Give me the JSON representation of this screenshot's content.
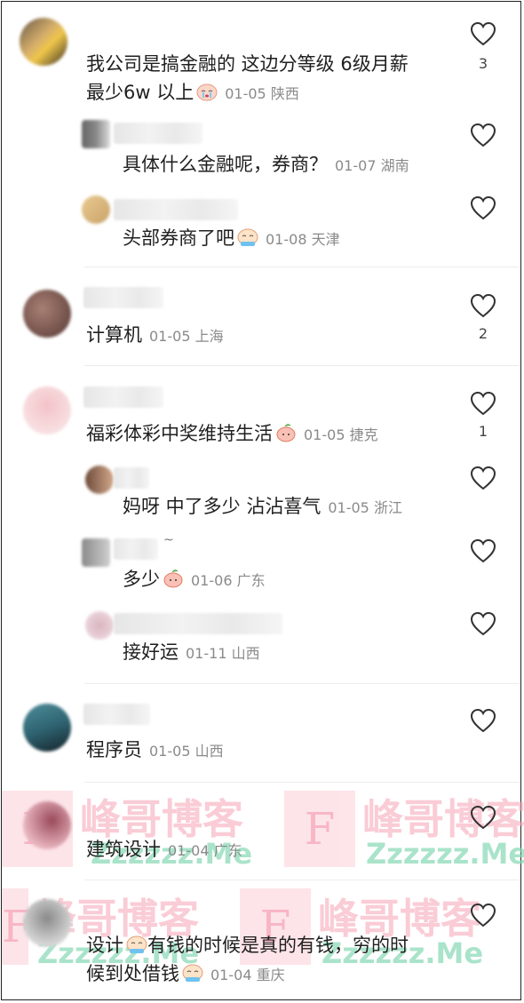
{
  "comments": [
    {
      "text": "我公司是搞金融的 这边分等级 6级月薪",
      "text2": "最少6w 以上",
      "time": "01-05",
      "loc": "陕西",
      "likes": "3"
    },
    {
      "text": "具体什么金融呢，券商？",
      "time": "01-07",
      "loc": "湖南"
    },
    {
      "text": "头部券商了吧",
      "time": "01-08",
      "loc": "天津"
    },
    {
      "text": "计算机",
      "time": "01-05",
      "loc": "上海",
      "likes": "2"
    },
    {
      "text": "福彩体彩中奖维持生活",
      "time": "01-05",
      "loc": "捷克",
      "likes": "1"
    },
    {
      "text": "妈呀 中了多少 沾沾喜气",
      "time": "01-05",
      "loc": "浙江"
    },
    {
      "text": "多少",
      "time": "01-06",
      "loc": "广东"
    },
    {
      "text": "接好运",
      "time": "01-11",
      "loc": "山西"
    },
    {
      "text": "程序员",
      "time": "01-05",
      "loc": "山西"
    },
    {
      "text": "建筑设计",
      "time": "01-04",
      "loc": "广东"
    },
    {
      "text": "设计",
      "text_b": "有钱的时候是真的有钱，穷的时",
      "text2": "候到处借钱",
      "time": "01-04",
      "loc": "重庆"
    }
  ],
  "watermark": {
    "letter": "F",
    "name": "峰哥博客",
    "domain": "Zzzzzz.Me"
  },
  "name_tilde": "~"
}
